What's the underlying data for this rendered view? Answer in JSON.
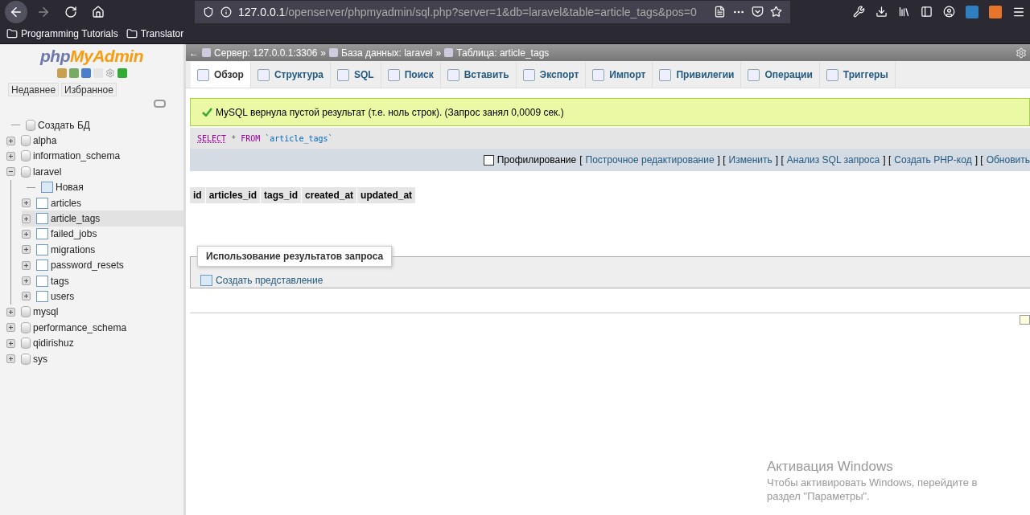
{
  "browser": {
    "url_host": "127.0.0.1",
    "url_path": "/openserver/phpmyadmin/sql.php?server=1&db=laravel&table=article_tags&pos=0",
    "bookmarks": [
      "Programming Tutorials",
      "Translator"
    ]
  },
  "sidebar": {
    "logo": {
      "prefix": "php",
      "name": "MyAdmin"
    },
    "tabs": [
      "Недавнее",
      "Избранное"
    ],
    "tree": [
      {
        "kind": "new",
        "label": "Создать БД"
      },
      {
        "kind": "db",
        "label": "alpha",
        "expanded": false,
        "selected": false
      },
      {
        "kind": "db",
        "label": "information_schema",
        "expanded": false,
        "selected": false
      },
      {
        "kind": "db",
        "label": "laravel",
        "expanded": true,
        "selected": false,
        "children": [
          {
            "kind": "new-table",
            "label": "Новая"
          },
          {
            "kind": "table",
            "label": "articles",
            "expanded": false,
            "selected": false
          },
          {
            "kind": "table",
            "label": "article_tags",
            "expanded": false,
            "selected": true
          },
          {
            "kind": "table",
            "label": "failed_jobs",
            "expanded": false,
            "selected": false
          },
          {
            "kind": "table",
            "label": "migrations",
            "expanded": false,
            "selected": false
          },
          {
            "kind": "table",
            "label": "password_resets",
            "expanded": false,
            "selected": false
          },
          {
            "kind": "table",
            "label": "tags",
            "expanded": false,
            "selected": false
          },
          {
            "kind": "table",
            "label": "users",
            "expanded": false,
            "selected": false
          }
        ]
      },
      {
        "kind": "db",
        "label": "mysql",
        "expanded": false,
        "selected": false
      },
      {
        "kind": "db",
        "label": "performance_schema",
        "expanded": false,
        "selected": false
      },
      {
        "kind": "db",
        "label": "qidirishuz",
        "expanded": false,
        "selected": false
      },
      {
        "kind": "db",
        "label": "sys",
        "expanded": false,
        "selected": false
      }
    ]
  },
  "breadcrumb": {
    "back": "←",
    "separator": "»",
    "items": [
      "Сервер: 127.0.0.1:3306",
      "База данных: laravel",
      "Таблица: article_tags"
    ]
  },
  "tabs": [
    {
      "label": "Обзор",
      "selected": true
    },
    {
      "label": "Структура",
      "selected": false
    },
    {
      "label": "SQL",
      "selected": false
    },
    {
      "label": "Поиск",
      "selected": false
    },
    {
      "label": "Вставить",
      "selected": false
    },
    {
      "label": "Экспорт",
      "selected": false
    },
    {
      "label": "Импорт",
      "selected": false
    },
    {
      "label": "Привилегии",
      "selected": false
    },
    {
      "label": "Операции",
      "selected": false
    },
    {
      "label": "Триггеры",
      "selected": false
    }
  ],
  "notice": "MySQL вернула пустой результат (т.е. ноль строк). (Запрос занял 0,0009 сек.)",
  "sql_query": [
    {
      "kind": "keyword",
      "text": "SELECT"
    },
    {
      "kind": "op",
      "text": "*"
    },
    {
      "kind": "keyword",
      "text": "FROM"
    },
    {
      "kind": "name",
      "text": "`article_tags`"
    }
  ],
  "options": {
    "profiling": {
      "label": "Профилирование",
      "checked": false
    },
    "open_bracket": "[",
    "close_bracket": "]",
    "links": [
      "Построчное редактирование",
      "Изменить",
      "Анализ SQL запроса",
      "Создать PHP-код",
      "Обновить"
    ]
  },
  "table": {
    "columns": [
      "id",
      "articles_id",
      "tags_id",
      "created_at",
      "updated_at"
    ]
  },
  "query_results": {
    "legend": "Использование результатов запроса",
    "link": "Создать представление"
  },
  "os_notice": {
    "title": "Активация Windows",
    "lines": [
      "Чтобы активировать Windows, перейдите в",
      "раздел \"Параметры\"."
    ]
  }
}
